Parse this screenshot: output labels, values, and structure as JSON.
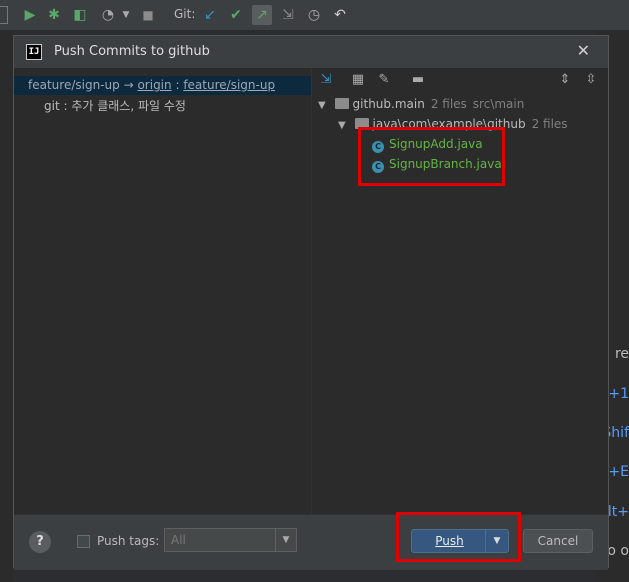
{
  "toolbar": {
    "git_label": "Git:"
  },
  "dialog": {
    "title": "Push Commits to github",
    "app_icon_text": "IJ",
    "left": {
      "branch_local": "feature/sign-up",
      "branch_arrow": "→",
      "remote": "origin",
      "sep": ":",
      "branch_remote": "feature/sign-up",
      "commit": "git : 추가 클래스, 파일 수정"
    },
    "tree": {
      "module": "github.main",
      "module_count": "2 files",
      "module_path": "src\\main",
      "package": "java\\com\\example\\github",
      "package_count": "2 files",
      "files": [
        "SignupAdd.java",
        "SignupBranch.java"
      ],
      "file_icon_letter": "C"
    },
    "bottom": {
      "help": "?",
      "push_tags_label": "Push tags:",
      "tags_value": "All",
      "push_button": "Push",
      "cancel_button": "Cancel"
    }
  },
  "background_fragments": [
    "re",
    "+1",
    "Shif",
    "+E",
    "Alt+",
    "o o"
  ],
  "colors": {
    "highlight": "#e00000",
    "file_green": "#62b543",
    "accent_blue": "#365880"
  }
}
